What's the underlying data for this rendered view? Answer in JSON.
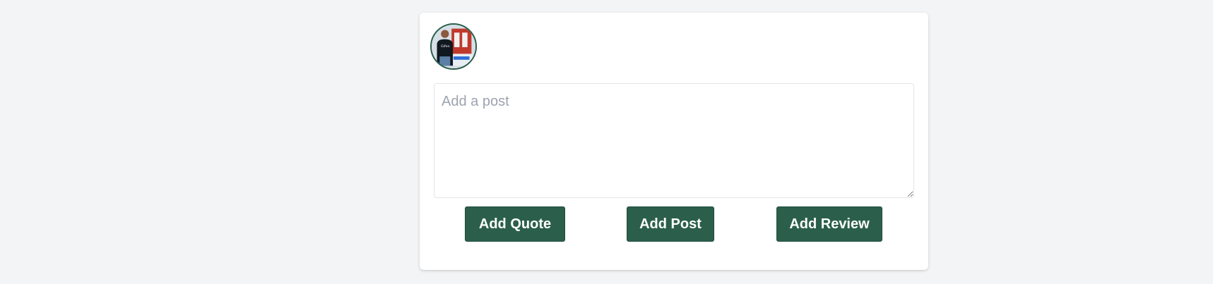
{
  "composer": {
    "avatar_icon": "user-photo-avatar",
    "textarea": {
      "placeholder": "Add a post",
      "value": ""
    },
    "buttons": {
      "add_quote": "Add Quote",
      "add_post": "Add Post",
      "add_review": "Add Review"
    }
  },
  "colors": {
    "background": "#f3f4f6",
    "card": "#ffffff",
    "button": "#2b5f4c",
    "button_text": "#ffffff",
    "avatar_border": "#2a5e4b"
  }
}
